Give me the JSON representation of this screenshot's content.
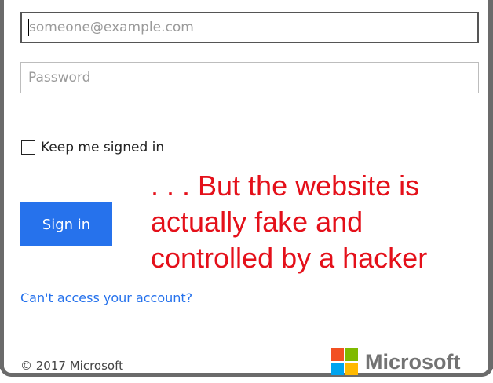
{
  "login_form": {
    "email_placeholder": "someone@example.com",
    "email_value": "",
    "password_placeholder": "Password",
    "password_value": "",
    "keep_signed_in_label": "Keep me signed in",
    "keep_signed_in_checked": false,
    "sign_in_label": "Sign in",
    "cant_access_link": "Can't access your account?"
  },
  "annotation": {
    "lines": [
      ". . . But the website is",
      "actually fake and",
      "controlled by a hacker"
    ]
  },
  "footer": {
    "copyright": "© 2017 Microsoft",
    "brand_name": "Microsoft"
  },
  "colors": {
    "accent_blue": "#2672ec",
    "annotation_red": "#e4101a",
    "logo_red": "#f25022",
    "logo_green": "#7fba00",
    "logo_blue": "#00a4ef",
    "logo_yellow": "#ffb900"
  },
  "icons": {
    "brand_logo": "microsoft-four-squares-icon"
  }
}
